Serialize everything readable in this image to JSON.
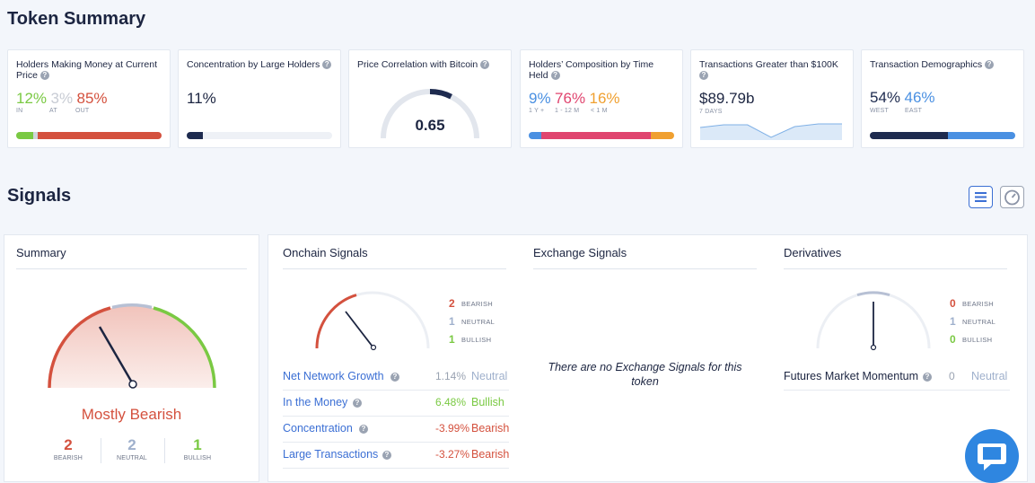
{
  "header": {
    "title": "Token Summary"
  },
  "summary_cards": {
    "holders_money": {
      "title": "Holders Making Money at Current Price",
      "in_value": "12%",
      "at_value": "3%",
      "out_value": "85%",
      "in_label": "IN",
      "at_label": "AT",
      "out_label": "OUT",
      "in_fraction": 0.12,
      "at_fraction": 0.03,
      "out_fraction": 0.85,
      "colors": {
        "in": "#7ac943",
        "at": "#d0d4db",
        "out": "#d4513e"
      }
    },
    "concentration": {
      "title": "Concentration by Large Holders",
      "value": "11%",
      "fraction": 0.11
    },
    "correlation": {
      "title": "Price Correlation with Bitcoin",
      "value": "0.65",
      "fraction": 0.65
    },
    "composition": {
      "title": "Holders’ Composition by Time Held",
      "v1": "9%",
      "v2": "76%",
      "v3": "16%",
      "l1": "1 Y +",
      "l2": "1 - 12 M",
      "l3": "< 1 M",
      "fractions": [
        0.09,
        0.76,
        0.16
      ]
    },
    "transactions": {
      "title": "Transactions Greater than $100K",
      "value": "$89.79b",
      "period": "7 DAYS",
      "sparkline": [
        0.7,
        0.85,
        0.85,
        0.15,
        0.75,
        0.9,
        0.9
      ]
    },
    "demographics": {
      "title": "Transaction Demographics",
      "west_value": "54%",
      "east_value": "46%",
      "west_label": "WEST",
      "east_label": "EAST",
      "west_fraction": 0.54
    }
  },
  "signals_section": {
    "title": "Signals",
    "list_view_icon": "list-icon",
    "gauge_view_icon": "gauge-icon"
  },
  "summary_panel": {
    "title": "Summary",
    "verdict": "Mostly Bearish",
    "bearish_count": "2",
    "neutral_count": "2",
    "bullish_count": "1",
    "bearish_label": "BEARISH",
    "neutral_label": "NEUTRAL",
    "bullish_label": "BULLISH"
  },
  "onchain": {
    "title": "Onchain Signals",
    "bearish_count": "2",
    "neutral_count": "1",
    "bullish_count": "1",
    "bearish_label": "BEARISH",
    "neutral_label": "NEUTRAL",
    "bullish_label": "BULLISH",
    "rows": [
      {
        "name": "Net Network Growth",
        "value": "1.14%",
        "status": "Neutral"
      },
      {
        "name": "In the Money",
        "value": "6.48%",
        "status": "Bullish"
      },
      {
        "name": "Concentration",
        "value": "-3.99%",
        "status": "Bearish"
      },
      {
        "name": "Large Transactions",
        "value": "-3.27%",
        "status": "Bearish"
      }
    ]
  },
  "exchange": {
    "title": "Exchange Signals",
    "empty_message": "There are no Exchange Signals for this token"
  },
  "derivatives": {
    "title": "Derivatives",
    "bearish_count": "0",
    "neutral_count": "1",
    "bullish_count": "0",
    "bearish_label": "BEARISH",
    "neutral_label": "NEUTRAL",
    "bullish_label": "BULLISH",
    "rows": [
      {
        "name": "Futures Market Momentum",
        "value": "0",
        "status": "Neutral"
      }
    ]
  },
  "chat_widget": {
    "icon": "chat-bubble-icon"
  }
}
